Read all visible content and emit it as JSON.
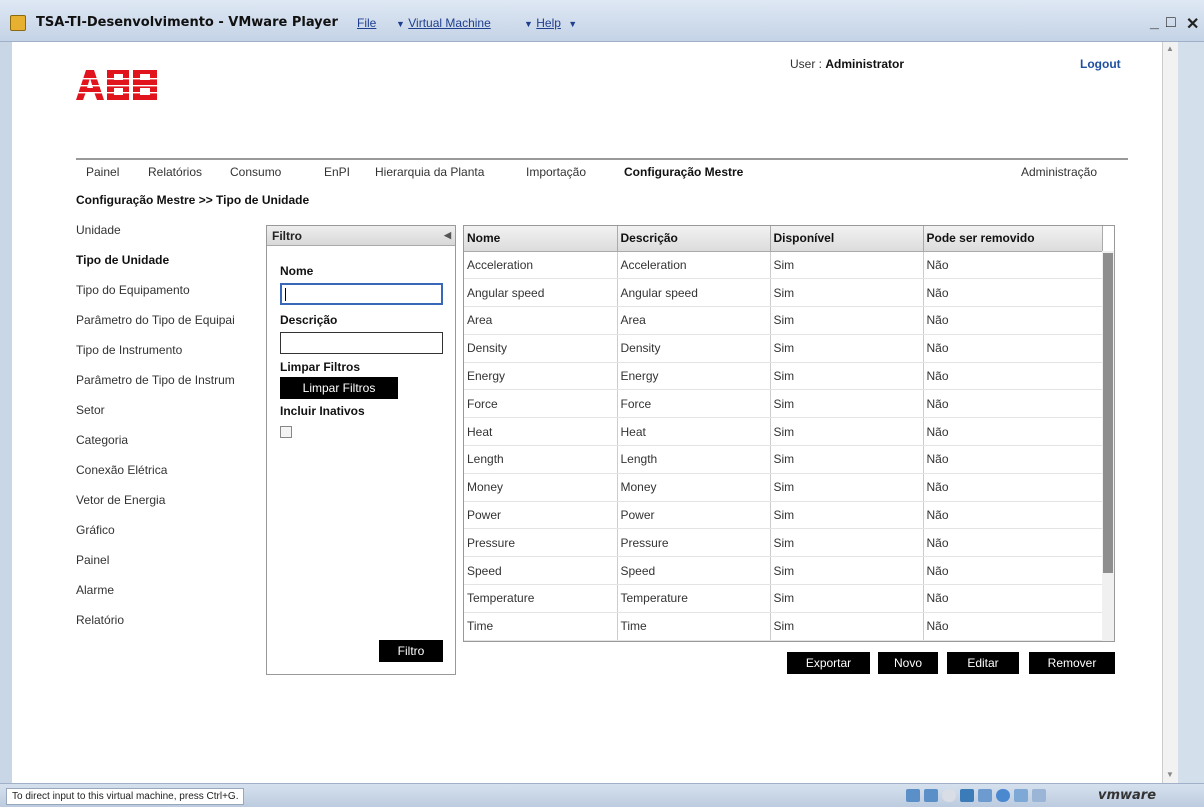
{
  "window": {
    "title": "TSA-TI-Desenvolvimento - VMware Player",
    "menus": [
      "File",
      "Virtual Machine",
      "Help"
    ],
    "minimize": "_",
    "restore": "□",
    "close": "✕"
  },
  "status": {
    "message": "To direct input to this virtual machine, press Ctrl+G.",
    "brand": "vmware"
  },
  "header": {
    "user_label": "User :",
    "user_name": "Administrator",
    "logout": "Logout"
  },
  "nav": {
    "items": [
      "Painel",
      "Relatórios",
      "Consumo",
      "EnPI",
      "Hierarquia da Planta",
      "Importação",
      "Configuração Mestre",
      "Administração"
    ],
    "active": "Configuração Mestre"
  },
  "breadcrumb": "Configuração Mestre >> Tipo de Unidade",
  "sidebar": {
    "items": [
      "Unidade",
      "Tipo de Unidade",
      "Tipo do Equipamento",
      "Parâmetro do Tipo de Equipai",
      "Tipo de Instrumento",
      "Parâmetro de Tipo de Instrum",
      "Setor",
      "Categoria",
      "Conexão Elétrica",
      "Vetor de Energia",
      "Gráfico",
      "Painel",
      "Alarme",
      "Relatório"
    ],
    "active": "Tipo de Unidade"
  },
  "filter": {
    "title": "Filtro",
    "name_label": "Nome",
    "name_value": "",
    "desc_label": "Descrição",
    "desc_value": "",
    "clear_label": "Limpar Filtros",
    "clear_button": "Limpar Filtros",
    "inactive_label": "Incluir Inativos",
    "inactive_checked": false,
    "submit": "Filtro"
  },
  "table": {
    "columns": [
      "Nome",
      "Descrição",
      "Disponível",
      "Pode ser removido"
    ],
    "rows": [
      [
        "Acceleration",
        "Acceleration",
        "Sim",
        "Não"
      ],
      [
        "Angular speed",
        "Angular speed",
        "Sim",
        "Não"
      ],
      [
        "Area",
        "Area",
        "Sim",
        "Não"
      ],
      [
        "Density",
        "Density",
        "Sim",
        "Não"
      ],
      [
        "Energy",
        "Energy",
        "Sim",
        "Não"
      ],
      [
        "Force",
        "Force",
        "Sim",
        "Não"
      ],
      [
        "Heat",
        "Heat",
        "Sim",
        "Não"
      ],
      [
        "Length",
        "Length",
        "Sim",
        "Não"
      ],
      [
        "Money",
        "Money",
        "Sim",
        "Não"
      ],
      [
        "Power",
        "Power",
        "Sim",
        "Não"
      ],
      [
        "Pressure",
        "Pressure",
        "Sim",
        "Não"
      ],
      [
        "Speed",
        "Speed",
        "Sim",
        "Não"
      ],
      [
        "Temperature",
        "Temperature",
        "Sim",
        "Não"
      ],
      [
        "Time",
        "Time",
        "Sim",
        "Não"
      ]
    ]
  },
  "actions": {
    "export": "Exportar",
    "new": "Novo",
    "edit": "Editar",
    "remove": "Remover"
  },
  "colors": {
    "abb_red": "#e1141e",
    "button_black": "#000000",
    "nav_line": "#999999"
  }
}
